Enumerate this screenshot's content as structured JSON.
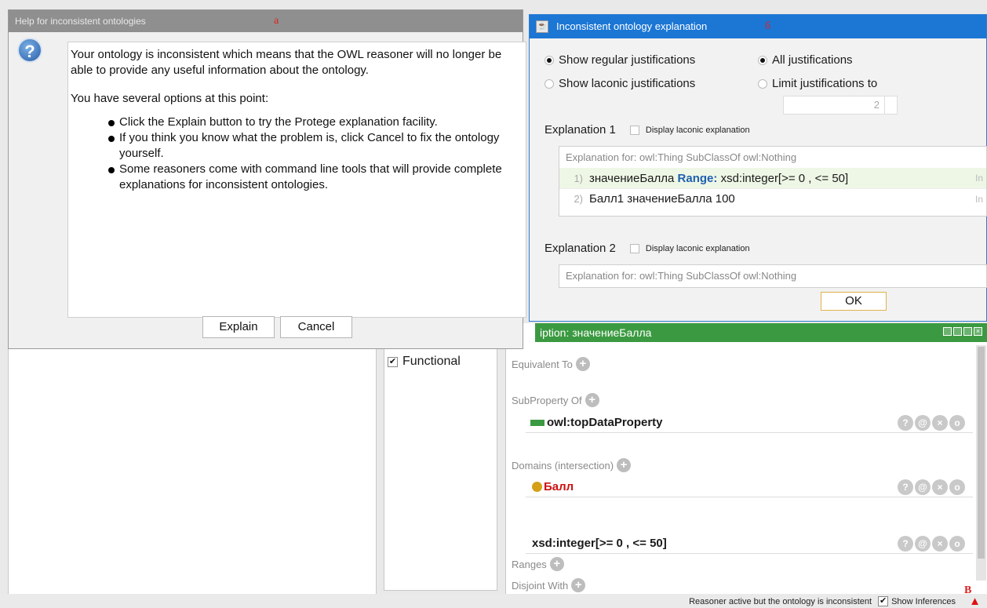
{
  "background": {
    "characteristics": {
      "functional_label": "Functional",
      "functional_checked": true
    },
    "description": {
      "header_title": "iption: значениеБалла",
      "equivalent_to_label": "Equivalent To",
      "subproperty_of_label": "SubProperty Of",
      "subproperty_value": "owl:topDataProperty",
      "domains_label": "Domains (intersection)",
      "domain_value": "Балл",
      "ranges_label": "Ranges",
      "range_value": "xsd:integer[>= 0 , <= 50]",
      "disjoint_label": "Disjoint With"
    },
    "status": {
      "text": "Reasoner active but the ontology is inconsistent",
      "show_inferences_label": "Show Inferences",
      "show_inferences_checked": true
    },
    "mark_v": "В"
  },
  "dialog_a": {
    "title": "Help for inconsistent ontologies",
    "mark": "а",
    "intro": "Your ontology is inconsistent which means that the OWL reasoner will no longer be able to provide any useful information about the ontology.",
    "options_heading": "You have several options at this point:",
    "bullets": [
      "Click the Explain button to try the Protege explanation facility.",
      "If you think you know what the problem is, click Cancel to fix the ontology yourself.",
      "Some reasoners come with command line tools that will provide complete explanations for inconsistent ontologies."
    ],
    "explain_label": "Explain",
    "cancel_label": "Cancel"
  },
  "dialog_b": {
    "title": "Inconsistent ontology explanation",
    "mark": "б",
    "show_regular": "Show regular justifications",
    "show_laconic": "Show laconic justifications",
    "all_justifications": "All justifications",
    "limit_justifications": "Limit justifications to",
    "limit_value": "2",
    "explanations": [
      {
        "title": "Explanation 1",
        "laconic_label": "Display laconic explanation",
        "header": "Explanation for: owl:Thing SubClassOf owl:Nothing",
        "axioms": [
          {
            "num": "1)",
            "subject": "значениеБалла",
            "keyword": "Range:",
            "rest": "xsd:integer[>= 0 , <= 50]",
            "tail": "In"
          },
          {
            "num": "2)",
            "subject": "Балл1 значениеБалла 100",
            "keyword": "",
            "rest": "",
            "tail": "In"
          }
        ]
      },
      {
        "title": "Explanation 2",
        "laconic_label": "Display laconic explanation",
        "header": "Explanation for: owl:Thing SubClassOf owl:Nothing"
      }
    ],
    "ok_label": "OK"
  },
  "colors": {
    "header_green": "#3b9a41",
    "title_blue": "#1b76d4",
    "keyword_blue": "#1f5faf",
    "domain_red": "#cc1111",
    "mark_red": "#d22222"
  }
}
